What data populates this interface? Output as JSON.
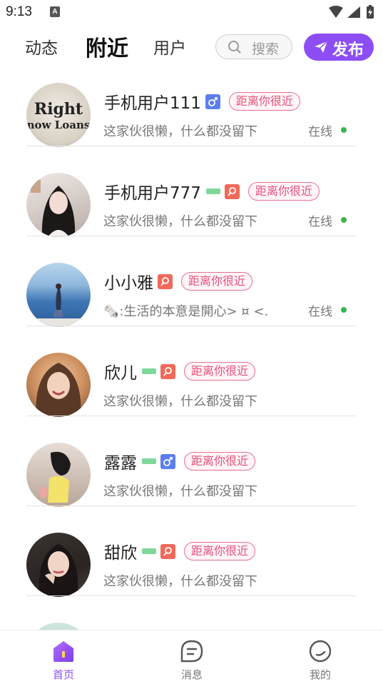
{
  "status_bar": {
    "time": "9:13",
    "notif_letter": "A"
  },
  "topnav": {
    "tabs": [
      {
        "label": "动态"
      },
      {
        "label": "附近"
      },
      {
        "label": "用户"
      }
    ],
    "search_placeholder": "搜索",
    "publish_label": "发布",
    "accent_color": "#8c4df5"
  },
  "users": [
    {
      "name": "手机用户111",
      "gender": "male",
      "vip": false,
      "distance": "距离你很近",
      "bio": "这家伙很懒，什么都没留下",
      "status": "在线"
    },
    {
      "name": "手机用户777",
      "gender": "female",
      "vip": true,
      "distance": "距离你很近",
      "bio": "这家伙很懒，什么都没留下",
      "status": "在线"
    },
    {
      "name": "小小雅",
      "gender": "female",
      "vip": false,
      "distance": "距离你很近",
      "bio": "🗞️:生活的本意是開心> ¤ <.",
      "status": "在线"
    },
    {
      "name": "欣儿",
      "gender": "female",
      "vip": true,
      "distance": "距离你很近",
      "bio": "这家伙很懒，什么都没留下",
      "status": ""
    },
    {
      "name": "露露",
      "gender": "male",
      "vip": true,
      "distance": "距离你很近",
      "bio": "这家伙很懒，什么都没留下",
      "status": ""
    },
    {
      "name": "甜欣",
      "gender": "female",
      "vip": true,
      "distance": "距离你很近",
      "bio": "这家伙很懒，什么都没留下",
      "status": ""
    }
  ],
  "avatar_text": {
    "line1": "Right",
    "line2": "now Loans"
  },
  "bottom_nav": [
    {
      "label": "首页",
      "icon": "home-icon",
      "active": true
    },
    {
      "label": "消息",
      "icon": "message-icon",
      "active": false
    },
    {
      "label": "我的",
      "icon": "profile-icon",
      "active": false
    }
  ]
}
